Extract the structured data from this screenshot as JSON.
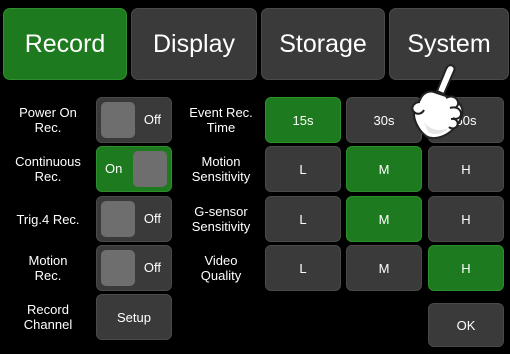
{
  "tabs": [
    {
      "label": "Record",
      "active": true
    },
    {
      "label": "Display",
      "active": false
    },
    {
      "label": "Storage",
      "active": false
    },
    {
      "label": "System",
      "active": false
    }
  ],
  "left": {
    "power_on": {
      "label": "Power On\nRec.",
      "state": "Off"
    },
    "continuous": {
      "label": "Continuous\nRec.",
      "state": "On"
    },
    "trig4": {
      "label": "Trig.4 Rec.",
      "state": "Off"
    },
    "motion_rec": {
      "label": "Motion\nRec.",
      "state": "Off"
    },
    "record_channel": {
      "label": "Record\nChannel",
      "button": "Setup"
    }
  },
  "settings": {
    "event_time": {
      "label": "Event Rec.\nTime",
      "options": [
        "15s",
        "30s",
        "60s"
      ],
      "selected": "15s"
    },
    "motion_sens": {
      "label": "Motion\nSensitivity",
      "options": [
        "L",
        "M",
        "H"
      ],
      "selected": "M"
    },
    "gsensor_sens": {
      "label": "G-sensor\nSensitivity",
      "options": [
        "L",
        "M",
        "H"
      ],
      "selected": "M"
    },
    "video_quality": {
      "label": "Video\nQuality",
      "options": [
        "L",
        "M",
        "H"
      ],
      "selected": "H"
    }
  },
  "ok_label": "OK",
  "colors": {
    "selected": "#1e7a1e",
    "button": "#3a3a3a",
    "background": "#000000"
  },
  "pointer": "hand-pointer-icon"
}
